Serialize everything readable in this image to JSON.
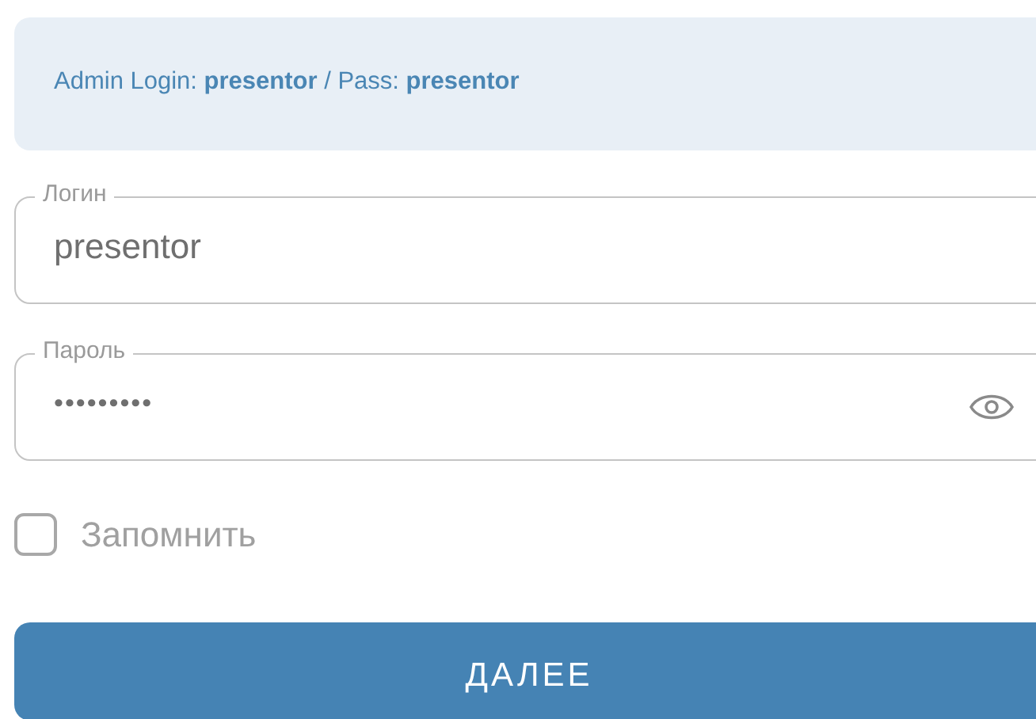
{
  "notice": "Admin Login: **presentor** / Pass: **presentor**",
  "fields": [
    {
      "kind": "text",
      "label": "Логин",
      "value": "presentor"
    },
    {
      "kind": "password",
      "label": "Пароль",
      "value": "•••••••••"
    }
  ],
  "remember": {
    "label": "Запомнить",
    "checked": false
  },
  "submit": "ДАЛЕЕ"
}
